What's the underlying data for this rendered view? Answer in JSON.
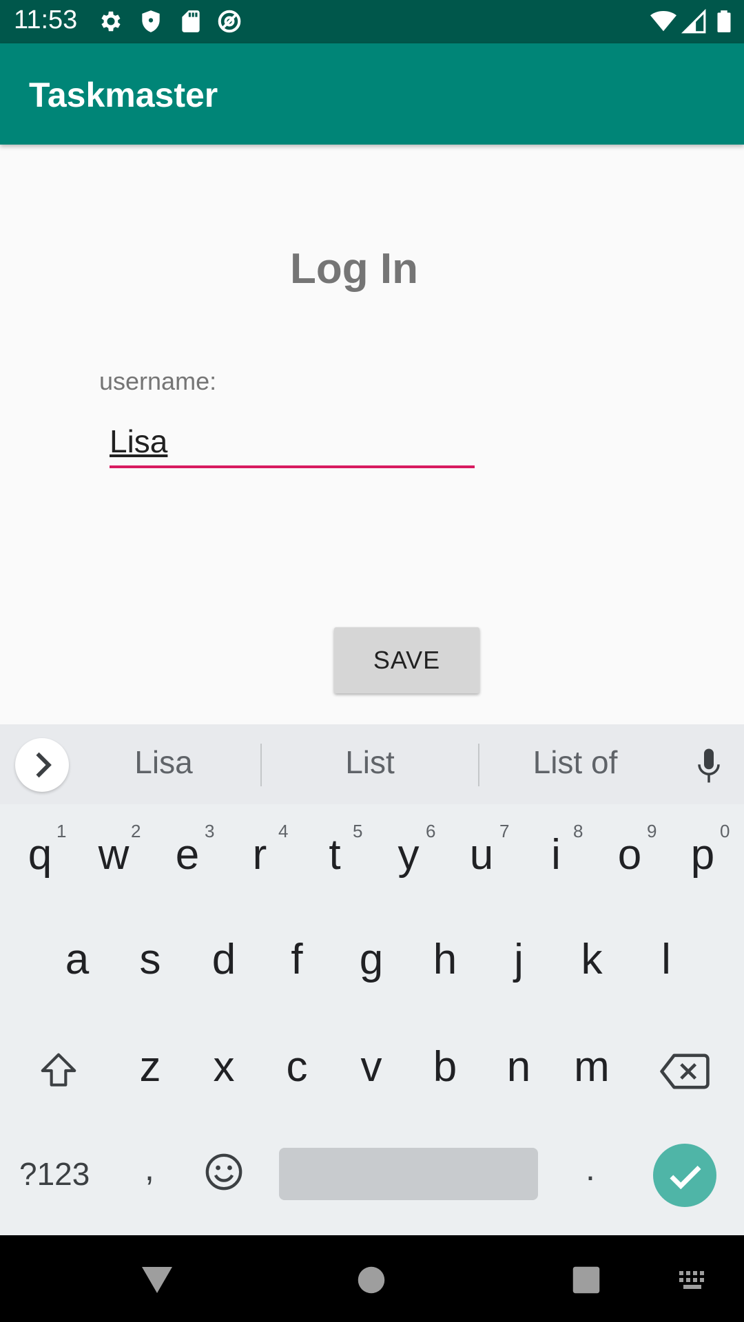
{
  "status_bar": {
    "time": "11:53",
    "icons": [
      "gear-icon",
      "shield-icon",
      "sd-card-icon",
      "at-sign-icon",
      "wifi-icon",
      "cell-signal-icon",
      "battery-icon"
    ]
  },
  "app_bar": {
    "title": "Taskmaster"
  },
  "main": {
    "title": "Log In",
    "username_label": "username:",
    "username_value": "Lisa",
    "save_label": "SAVE"
  },
  "keyboard": {
    "suggestions": [
      "Lisa",
      "List",
      "List of"
    ],
    "row1": [
      {
        "key": "q",
        "hint": "1"
      },
      {
        "key": "w",
        "hint": "2"
      },
      {
        "key": "e",
        "hint": "3"
      },
      {
        "key": "r",
        "hint": "4"
      },
      {
        "key": "t",
        "hint": "5"
      },
      {
        "key": "y",
        "hint": "6"
      },
      {
        "key": "u",
        "hint": "7"
      },
      {
        "key": "i",
        "hint": "8"
      },
      {
        "key": "o",
        "hint": "9"
      },
      {
        "key": "p",
        "hint": "0"
      }
    ],
    "row2": [
      "a",
      "s",
      "d",
      "f",
      "g",
      "h",
      "j",
      "k",
      "l"
    ],
    "row3": [
      "z",
      "x",
      "c",
      "v",
      "b",
      "n",
      "m"
    ],
    "symbols_label": "?123",
    "comma_label": ",",
    "period_label": "."
  },
  "colors": {
    "status_bar": "#00574b",
    "app_bar": "#008577",
    "input_underline": "#d81b60",
    "enter_key": "#4fb5a7"
  }
}
